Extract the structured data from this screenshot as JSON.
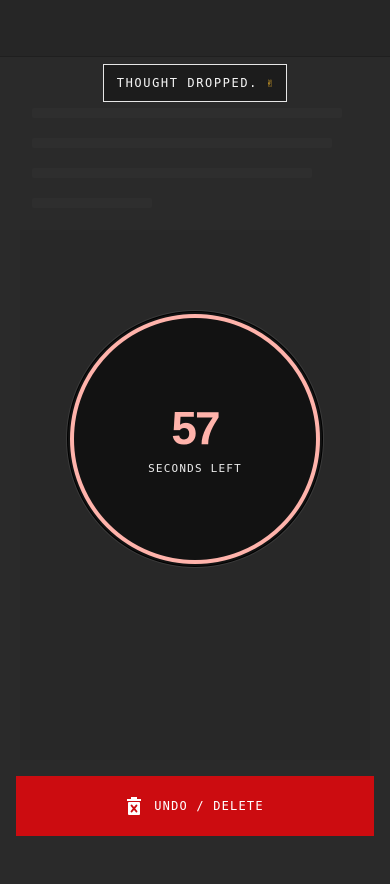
{
  "toast": {
    "message": "THOUGHT DROPPED.",
    "emoji": "✌"
  },
  "timer": {
    "seconds": "57",
    "label": "SECONDS LEFT",
    "ring_color": "#ffb3ab",
    "progress_fraction": 1.0
  },
  "undo_button": {
    "icon": "delete-x-icon",
    "label": "UNDO / DELETE",
    "color": "#cc0c10"
  }
}
